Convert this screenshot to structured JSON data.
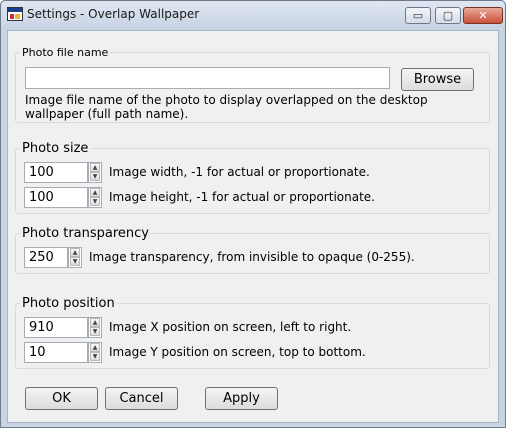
{
  "window": {
    "title": "Settings - Overlap Wallpaper",
    "controls": {
      "minimize": "▭",
      "maximize": "▢",
      "close": "✕"
    }
  },
  "file_group": {
    "label": "Photo file name",
    "value": "",
    "browse_label": "Browse",
    "description": "Image file name of the photo to display overlapped on the desktop wallpaper (full path name)."
  },
  "size_group": {
    "label": "Photo size",
    "width_value": "100",
    "width_desc": "Image width, -1 for actual or proportionate.",
    "height_value": "100",
    "height_desc": "Image height, -1 for actual or proportionate."
  },
  "transparency_group": {
    "label": "Photo transparency",
    "value": "250",
    "desc": "Image transparency, from invisible to opaque (0-255)."
  },
  "position_group": {
    "label": "Photo position",
    "x_value": "910",
    "x_desc": "Image X position on screen, left to right.",
    "y_value": "10",
    "y_desc": "Image Y position on screen, top to bottom."
  },
  "buttons": {
    "ok": "OK",
    "cancel": "Cancel",
    "apply": "Apply"
  }
}
